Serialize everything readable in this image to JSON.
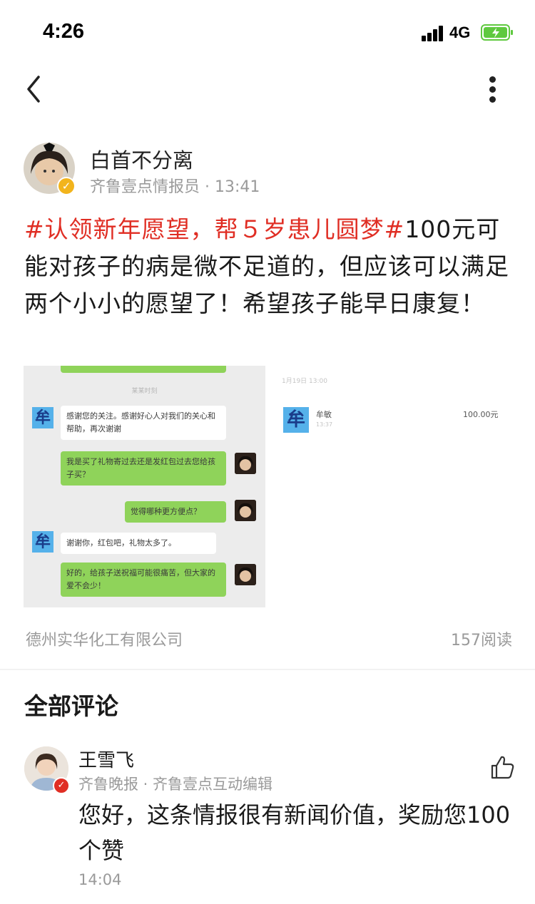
{
  "status_bar": {
    "time": "4:26",
    "network": "4G"
  },
  "author": {
    "name": "白首不分离",
    "role": "齐鲁壹点情报员",
    "separator": "·",
    "time": "13:41"
  },
  "post": {
    "hashtag": "#认领新年愿望，帮５岁患儿圆梦#",
    "text": "100元可能对孩子的病是微不足道的，但应该可以满足两个小小的愿望了！希望孩子能早日康复！"
  },
  "chat_image": {
    "time_label": "某某时刻",
    "avatar_char": "牟",
    "messages": [
      {
        "side": "left",
        "text": "感谢您的关注。感谢好心人对我们的关心和帮助，再次谢谢"
      },
      {
        "side": "right",
        "text": "我是买了礼物寄过去还是发红包过去您给孩子买？"
      },
      {
        "side": "right",
        "text": "觉得哪种更方便点？"
      },
      {
        "side": "left",
        "text": "谢谢你，红包吧，礼物太多了。"
      },
      {
        "side": "right",
        "text": "好的，给孩子送祝福可能很痛苦，但大家的爱不会少！"
      }
    ]
  },
  "payment_image": {
    "header": "1月19日 13:00",
    "avatar_char": "牟",
    "payee": "牟敏",
    "payee_sub": "13:37",
    "amount": "100.00元"
  },
  "post_footer": {
    "source": "德州实华化工有限公司",
    "reads": "157阅读"
  },
  "comments": {
    "title": "全部评论",
    "items": [
      {
        "name": "王雪飞",
        "meta": "齐鲁晚报 · 齐鲁壹点互动编辑",
        "text": "您好，这条情报很有新闻价值，奖励您100个赞",
        "time": "14:04"
      }
    ]
  },
  "colors": {
    "hashtag": "#e02e24",
    "chat_green": "#8fd35a",
    "verified_gold": "#f2b41c",
    "verified_red": "#e02e24"
  }
}
